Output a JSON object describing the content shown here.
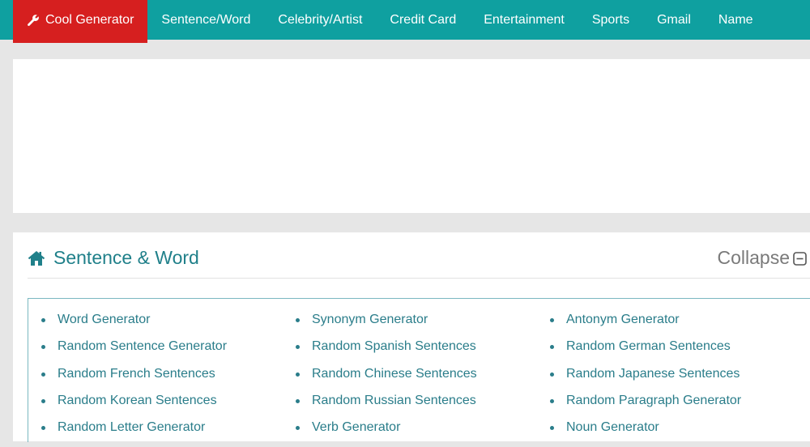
{
  "nav": {
    "items": [
      {
        "label": "Cool Generator",
        "icon": "wrench-icon",
        "active": true
      },
      {
        "label": "Sentence/Word"
      },
      {
        "label": "Celebrity/Artist"
      },
      {
        "label": "Credit Card"
      },
      {
        "label": "Entertainment"
      },
      {
        "label": "Sports"
      },
      {
        "label": "Gmail"
      },
      {
        "label": "Name"
      }
    ]
  },
  "section": {
    "icon": "home-icon",
    "title": "Sentence & Word",
    "collapse_label": "Collapse",
    "links": [
      "Word Generator",
      "Synonym Generator",
      "Antonym Generator",
      "Random Sentence Generator",
      "Random Spanish Sentences",
      "Random German Sentences",
      "Random French Sentences",
      "Random Chinese Sentences",
      "Random Japanese Sentences",
      "Random Korean Sentences",
      "Random Russian Sentences",
      "Random Paragraph Generator",
      "Random Letter Generator",
      "Verb Generator",
      "Noun Generator"
    ]
  },
  "colors": {
    "nav_bg": "#0fa0a0",
    "active_bg": "#d61f1f",
    "link": "#2a7d8a"
  }
}
